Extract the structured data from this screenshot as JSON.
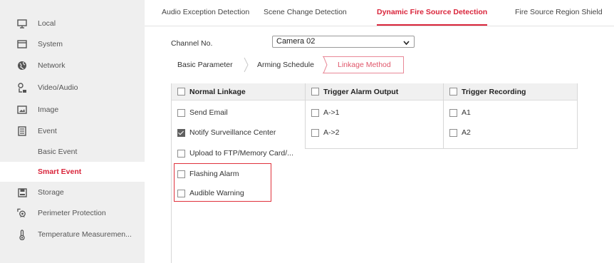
{
  "sidebar": {
    "items": [
      {
        "label": "Local",
        "icon": "monitor-icon"
      },
      {
        "label": "System",
        "icon": "window-icon"
      },
      {
        "label": "Network",
        "icon": "globe-icon"
      },
      {
        "label": "Video/Audio",
        "icon": "video-audio-icon"
      },
      {
        "label": "Image",
        "icon": "image-icon"
      },
      {
        "label": "Event",
        "icon": "event-list-icon"
      }
    ],
    "sub_items": [
      {
        "label": "Basic Event",
        "active": false
      },
      {
        "label": "Smart Event",
        "active": true
      }
    ],
    "items_after": [
      {
        "label": "Storage",
        "icon": "storage-icon"
      },
      {
        "label": "Perimeter Protection",
        "icon": "perimeter-icon"
      },
      {
        "label": "Temperature Measuremen...",
        "icon": "thermometer-icon"
      }
    ]
  },
  "tabs": [
    {
      "label": "Audio Exception Detection",
      "active": false
    },
    {
      "label": "Scene Change Detection",
      "active": false
    },
    {
      "label": "Dynamic Fire Source Detection",
      "active": true
    },
    {
      "label": "Fire Source Region Shield",
      "active": false
    }
  ],
  "channel": {
    "label": "Channel No.",
    "value": "Camera 02"
  },
  "subtabs": [
    {
      "label": "Basic Parameter",
      "active": false
    },
    {
      "label": "Arming Schedule",
      "active": false
    },
    {
      "label": "Linkage Method",
      "active": true
    }
  ],
  "linkage": {
    "normal": {
      "header": "Normal Linkage",
      "items": [
        {
          "label": "Send Email",
          "checked": false
        },
        {
          "label": "Notify Surveillance Center",
          "checked": true
        },
        {
          "label": "Upload to FTP/Memory Card/...",
          "checked": false
        },
        {
          "label": "Flashing Alarm",
          "checked": false
        },
        {
          "label": "Audible Warning",
          "checked": false
        }
      ]
    },
    "alarm_output": {
      "header": "Trigger Alarm Output",
      "items": [
        {
          "label": "A->1",
          "checked": false
        },
        {
          "label": "A->2",
          "checked": false
        }
      ]
    },
    "recording": {
      "header": "Trigger Recording",
      "items": [
        {
          "label": "A1",
          "checked": false
        },
        {
          "label": "A2",
          "checked": false
        }
      ]
    }
  },
  "colors": {
    "accent": "#d9243a",
    "highlight_box": "#e0323c",
    "sidebar_bg": "#efefef"
  }
}
